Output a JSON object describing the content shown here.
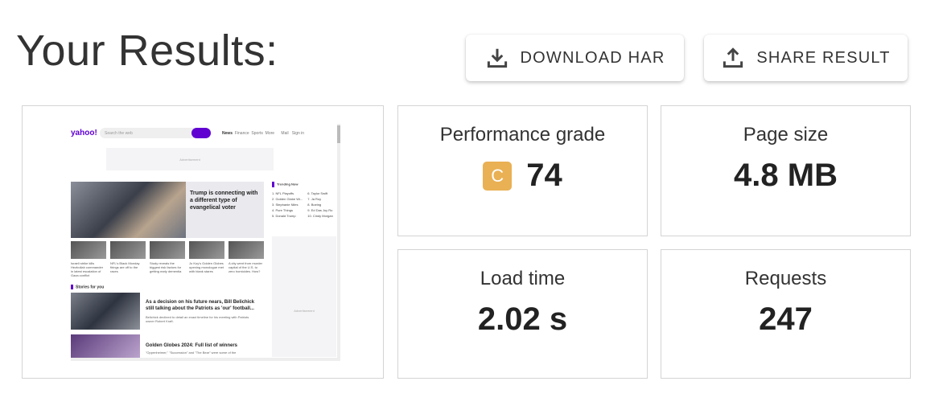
{
  "header": {
    "title": "Your Results:"
  },
  "actions": {
    "download_label": "DOWNLOAD HAR",
    "share_label": "SHARE RESULT"
  },
  "screenshot": {
    "logo": "yahoo!",
    "search_placeholder": "Search the web",
    "nav": [
      "News",
      "Finance",
      "Sports",
      "More"
    ],
    "nav_right": [
      "Mail",
      "Sign in"
    ],
    "ad_label": "Advertisement",
    "hero_headline": "Trump is connecting with a different type of evangelical voter",
    "trending_title": "Trending Now",
    "trending": [
      "1. NFL Playoffs",
      "2. Golden Globe Wi...",
      "3. Stephanie Niles",
      "4. Pure Things",
      "5. Donald Trump",
      "6. Taylor Swift",
      "7. Ja Roy",
      "8. Boeing",
      "9. Ed Das Joy Ro",
      "10. Cindy Morgan"
    ],
    "thumbs": [
      "Israeli strike kills Hezbollah commander in latest escalation of Gaza conflict",
      "NFL's Black Monday firings are off to the races",
      "Study reveals the biggest risk factors for getting early dementia",
      "Jo Koy's Golden Globes opening monologue met with blank stares",
      "A city went from murder capital of the U.S. to zero homicides. How?"
    ],
    "stories_title": "Stories for you",
    "story1_headline": "As a decision on his future nears, Bill Belichick still talking about the Patriots as 'our' football...",
    "story1_sub": "Belichick declined to detail an exact timeline for his meeting with Patriots owner Robert Kraft.",
    "story2_headline": "Golden Globes 2024: Full list of winners",
    "story2_sub": "\"Oppenheimer,\" \"Succession\" and \"The Bear\" were some of the"
  },
  "metrics": {
    "performance": {
      "label": "Performance grade",
      "grade": "C",
      "value": "74",
      "grade_color": "#e9b054"
    },
    "page_size": {
      "label": "Page size",
      "value": "4.8 MB"
    },
    "load_time": {
      "label": "Load time",
      "value": "2.02 s"
    },
    "requests": {
      "label": "Requests",
      "value": "247"
    }
  }
}
